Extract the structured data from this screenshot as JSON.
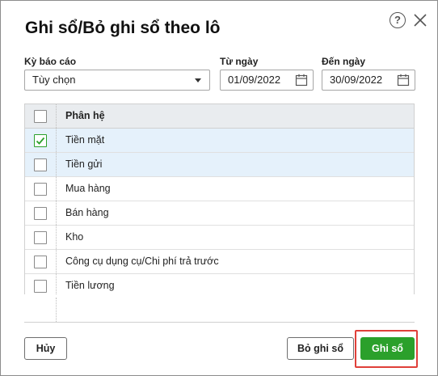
{
  "dialog": {
    "title": "Ghi sổ/Bỏ ghi sổ theo lô",
    "help_glyph": "?"
  },
  "filters": {
    "period_label": "Kỳ báo cáo",
    "period_value": "Tùy chọn",
    "from_label": "Từ ngày",
    "from_value": "01/09/2022",
    "to_label": "Đến ngày",
    "to_value": "30/09/2022"
  },
  "grid": {
    "header": "Phân hệ",
    "rows": [
      {
        "label": "Tiền mặt",
        "checked": true,
        "selected": true
      },
      {
        "label": "Tiền gửi",
        "checked": false,
        "selected": true
      },
      {
        "label": "Mua hàng",
        "checked": false,
        "selected": false
      },
      {
        "label": "Bán hàng",
        "checked": false,
        "selected": false
      },
      {
        "label": "Kho",
        "checked": false,
        "selected": false
      },
      {
        "label": "Công cụ dụng cụ/Chi phí trả trước",
        "checked": false,
        "selected": false
      },
      {
        "label": "Tiền lương",
        "checked": false,
        "selected": false
      }
    ]
  },
  "footer": {
    "cancel_label": "Hủy",
    "unpost_label": "Bỏ ghi sổ",
    "post_label": "Ghi sổ"
  },
  "colors": {
    "primary": "#2ba02b",
    "selected_row": "#e5f1fb",
    "highlight": "#e0403a"
  }
}
